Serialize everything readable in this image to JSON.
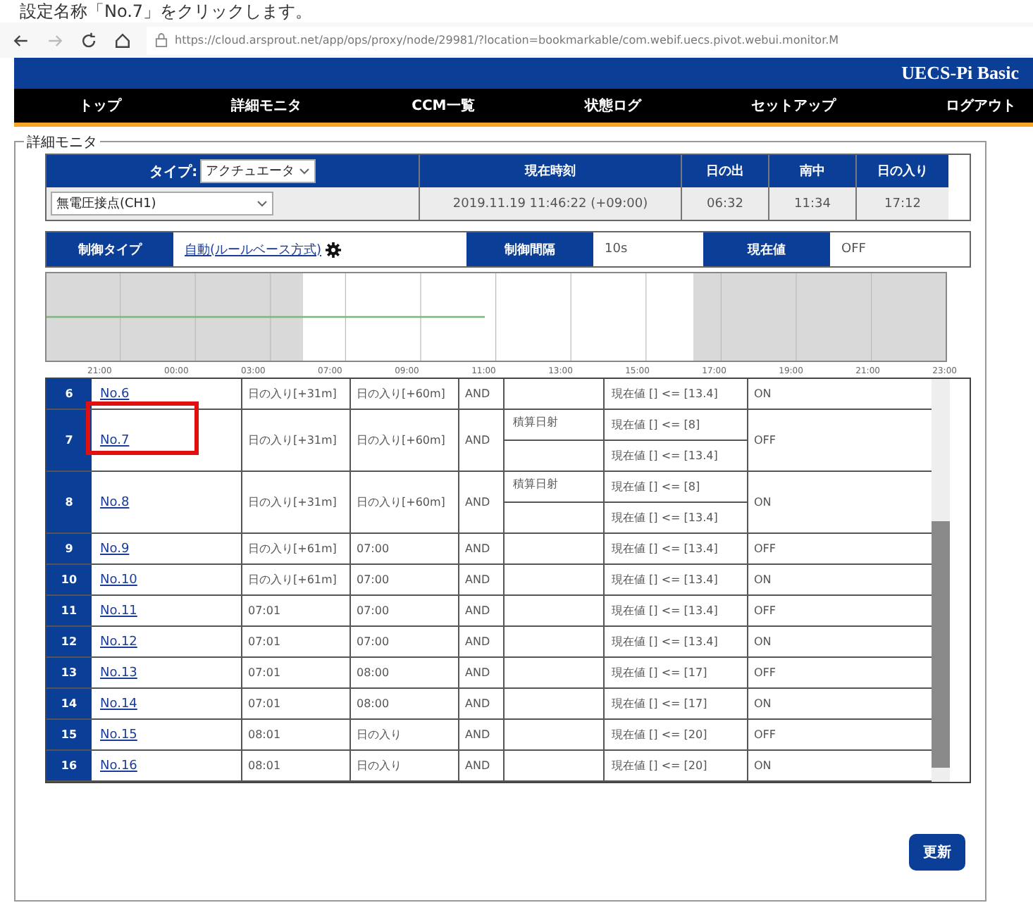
{
  "caption": "設定名称「No.7」をクリックします。",
  "browser": {
    "url": "https://cloud.arsprout.net/app/ops/proxy/node/29981/?location=bookmarkable/com.webif.uecs.pivot.webui.monitor.M"
  },
  "banner": {
    "title": "UECS-Pi Basic"
  },
  "nav": [
    {
      "label": "トップ"
    },
    {
      "label": "詳細モニタ"
    },
    {
      "label": "CCM一覧"
    },
    {
      "label": "状態ログ"
    },
    {
      "label": "セットアップ"
    },
    {
      "label": "ログアウト"
    }
  ],
  "panel": {
    "legend": "詳細モニタ",
    "type_label": "タイプ:",
    "type_value": "アクチュエータ",
    "channel": "無電圧接点(CH1)",
    "time_headers": [
      "現在時刻",
      "日の出",
      "南中",
      "日の入り"
    ],
    "time_values": [
      "2019.11.19 11:46:22 (+09:00)",
      "06:32",
      "11:34",
      "17:12"
    ],
    "control_type_label": "制御タイプ",
    "control_type_value": "自動(ルールベース方式)",
    "interval_label": "制御間隔",
    "interval_value": "10s",
    "current_label": "現在値",
    "current_value": "OFF",
    "time_labels": [
      "21:00",
      "00:00",
      "03:00",
      "07:00",
      "09:00",
      "11:00",
      "13:00",
      "15:00",
      "17:00",
      "19:00",
      "21:00",
      "23:00"
    ]
  },
  "rules": [
    {
      "index": "6",
      "name": "No.6",
      "start": "日の入り[+31m]",
      "end": "日の入り[+60m]",
      "logic": "AND",
      "conditions": [
        {
          "expr": "現在値 [] <= [13.4]"
        }
      ],
      "output": "ON",
      "highlighted": false
    },
    {
      "index": "7",
      "name": "No.7",
      "start": "日の入り[+31m]",
      "end": "日の入り[+60m]",
      "logic": "AND",
      "conditions": [
        {
          "sensor": "積算日射",
          "expr": "現在値 [] <= [8]"
        },
        {
          "expr": "現在値 [] <= [13.4]"
        }
      ],
      "output": "OFF",
      "highlighted": true
    },
    {
      "index": "8",
      "name": "No.8",
      "start": "日の入り[+31m]",
      "end": "日の入り[+60m]",
      "logic": "AND",
      "conditions": [
        {
          "sensor": "積算日射",
          "expr": "現在値 [] <= [8]"
        },
        {
          "expr": "現在値 [] <= [13.4]"
        }
      ],
      "output": "ON",
      "highlighted": false
    },
    {
      "index": "9",
      "name": "No.9",
      "start": "日の入り[+61m]",
      "end": "07:00",
      "logic": "AND",
      "conditions": [
        {
          "expr": "現在値 [] <= [13.4]"
        }
      ],
      "output": "OFF",
      "highlighted": false
    },
    {
      "index": "10",
      "name": "No.10",
      "start": "日の入り[+61m]",
      "end": "07:00",
      "logic": "AND",
      "conditions": [
        {
          "expr": "現在値 [] <= [13.4]"
        }
      ],
      "output": "ON",
      "highlighted": false
    },
    {
      "index": "11",
      "name": "No.11",
      "start": "07:01",
      "end": "07:00",
      "logic": "AND",
      "conditions": [
        {
          "expr": "現在値 [] <= [13.4]"
        }
      ],
      "output": "OFF",
      "highlighted": false
    },
    {
      "index": "12",
      "name": "No.12",
      "start": "07:01",
      "end": "07:00",
      "logic": "AND",
      "conditions": [
        {
          "expr": "現在値 [] <= [13.4]"
        }
      ],
      "output": "ON",
      "highlighted": false
    },
    {
      "index": "13",
      "name": "No.13",
      "start": "07:01",
      "end": "08:00",
      "logic": "AND",
      "conditions": [
        {
          "expr": "現在値 [] <= [17]"
        }
      ],
      "output": "OFF",
      "highlighted": false
    },
    {
      "index": "14",
      "name": "No.14",
      "start": "07:01",
      "end": "08:00",
      "logic": "AND",
      "conditions": [
        {
          "expr": "現在値 [] <= [17]"
        }
      ],
      "output": "ON",
      "highlighted": false
    },
    {
      "index": "15",
      "name": "No.15",
      "start": "08:01",
      "end": "日の入り",
      "logic": "AND",
      "conditions": [
        {
          "expr": "現在値 [] <= [20]"
        }
      ],
      "output": "OFF",
      "highlighted": false
    },
    {
      "index": "16",
      "name": "No.16",
      "start": "08:01",
      "end": "日の入り",
      "logic": "AND",
      "conditions": [
        {
          "expr": "現在値 [] <= [20]"
        }
      ],
      "output": "ON",
      "highlighted": false
    }
  ],
  "update_button": "更新"
}
